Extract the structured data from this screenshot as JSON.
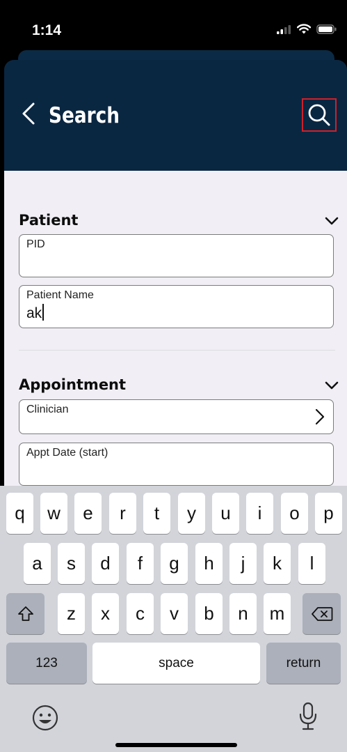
{
  "status_bar": {
    "time": "1:14"
  },
  "nav": {
    "title": "Search"
  },
  "patient": {
    "title": "Patient",
    "pid": {
      "label": "PID",
      "value": ""
    },
    "name": {
      "label": "Patient Name",
      "value": "ak"
    }
  },
  "appointment": {
    "title": "Appointment",
    "clinician": {
      "label": "Clinician",
      "value": ""
    },
    "appt_start": {
      "label": "Appt Date (start)",
      "value": ""
    }
  },
  "keyboard": {
    "row1": [
      "q",
      "w",
      "e",
      "r",
      "t",
      "y",
      "u",
      "i",
      "o",
      "p"
    ],
    "row2": [
      "a",
      "s",
      "d",
      "f",
      "g",
      "h",
      "j",
      "k",
      "l"
    ],
    "row3": [
      "z",
      "x",
      "c",
      "v",
      "b",
      "n",
      "m"
    ],
    "numbers": "123",
    "space": "space",
    "return": "return"
  },
  "colors": {
    "nav_bg": "#0a2742",
    "highlight": "#d0202a",
    "content_bg": "#f1eff5",
    "keyboard_bg": "#d2d4da"
  }
}
